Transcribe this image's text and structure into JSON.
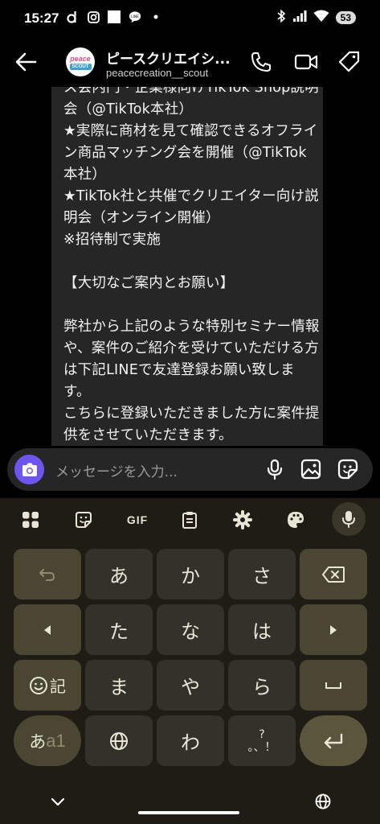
{
  "status_bar": {
    "time": "15:27",
    "battery": "53",
    "left_icons": [
      "d-app-icon",
      "instagram-icon",
      "square-icon",
      "line-icon",
      "dot"
    ],
    "right_icons": [
      "bluetooth-icon",
      "signal-icon",
      "wifi-icon",
      "battery-icon"
    ]
  },
  "header": {
    "name": "ピースクリエイシ...",
    "username": "peacecreation__scout",
    "avatar_text_top": "peace",
    "avatar_text_bottom": "SCOUT"
  },
  "message": {
    "text": "ス会内門・企業様向けTikTok Shop説明会（@TikTok本社）\n★実際に商材を見て確認できるオフライン商品マッチング会を開催（@TikTok本社）\n★TikTok社と共催でクリエイター向け説明会（オンライン開催）\n※招待制で実施\n\n【大切なご案内とお願い】\n\n弊社から上記のような特別セミナー情報や、案件のご紹介を受けていただける方は下記LINEで友達登録お願い致します。\nこちらに登録いただきました方に案件提供をさせていただきます。"
  },
  "composer": {
    "placeholder": "メッセージを入力..."
  },
  "keyboard": {
    "toolbar_gif": "GIF",
    "keys": {
      "a": "あ",
      "ka": "か",
      "sa": "さ",
      "ta": "た",
      "na": "な",
      "ha": "は",
      "ma": "ま",
      "ya": "や",
      "ra": "ら",
      "wa": "わ",
      "emoji_label": "記",
      "mode_a": "あ",
      "mode_b": "a1",
      "punct_top": "?",
      "punct_bottom": "。、！"
    }
  },
  "colors": {
    "accent": "#6f55f0",
    "bubble": "#262626",
    "keyboard_bg": "#1e1c14",
    "key": "#33312a",
    "key_dark": "#4a4632"
  }
}
